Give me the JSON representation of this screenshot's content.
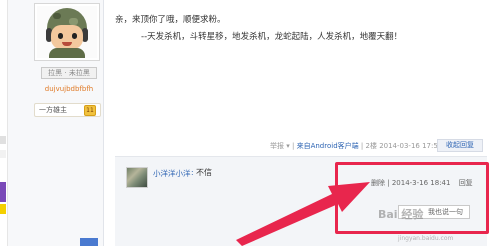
{
  "user": {
    "follow_label": "拉黑 · 未拉黑",
    "username": "dujvujbdbfbfh",
    "rank_title": "一方雄主",
    "rank_level": "11"
  },
  "post": {
    "line1": "亲，来顶你了哦，顺便求粉。",
    "line2": "--天发杀机，斗转星移，地发杀机，龙蛇起陆，人发杀机，地覆天翻！"
  },
  "post_meta": {
    "report": "举报",
    "report_arrow": "▾",
    "separator": "|",
    "client": "来自Android客户端",
    "floor": "2楼",
    "timestamp": "2014-03-16 17:51",
    "collapse_label": "收起回复"
  },
  "reply": {
    "author": "小洋洋小洋",
    "colon": ":",
    "content": "不信",
    "delete_label": "删除",
    "timestamp": "2014-3-16 18:41",
    "reply_label": "回复",
    "my_reply_label": "我也说一句"
  },
  "watermark": {
    "brand": "Bai 经验",
    "url": "jingyan.baidu.com"
  },
  "colors": {
    "highlight": "#e8264d",
    "link": "#2d64b3",
    "username": "#e07b28"
  },
  "icons": {
    "report_arrow": "caret-down-icon",
    "rank_level": "level-badge-icon",
    "annotation": "arrow-icon"
  }
}
